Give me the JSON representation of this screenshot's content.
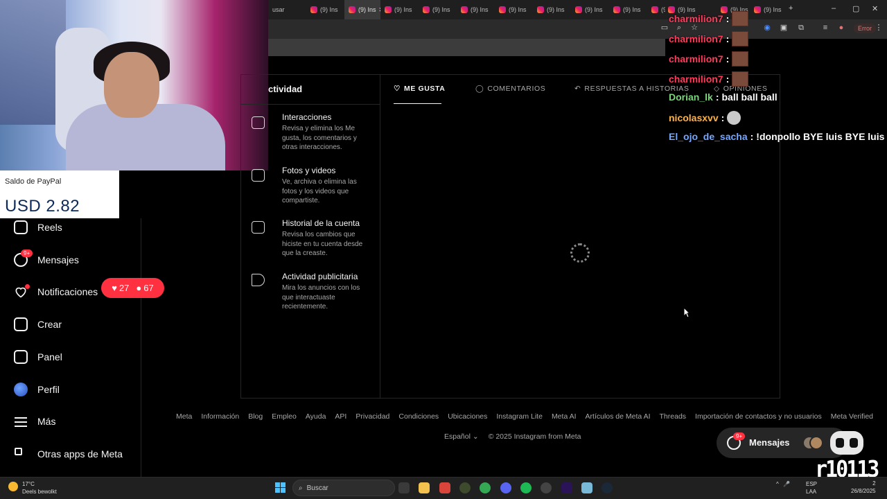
{
  "browser": {
    "tabs": [
      {
        "label": "usar"
      },
      {
        "label": "(9) Ins"
      },
      {
        "label": "(9) Ins",
        "active": true
      },
      {
        "label": "(9) Ins"
      },
      {
        "label": "(9) Ins"
      },
      {
        "label": "(9) Ins"
      },
      {
        "label": "(9) Ins"
      },
      {
        "label": "(9) Ins"
      },
      {
        "label": "(9) Ins"
      },
      {
        "label": "(9) Ins"
      },
      {
        "label": "(9) Ins"
      }
    ],
    "right_tabs": [
      "(9) Ins",
      "(9) Ins",
      "(9) Ins"
    ],
    "error_label": "Error"
  },
  "paypal": {
    "title": "Saldo de PayPal",
    "balance": "USD 2.82"
  },
  "sidebar": {
    "items": [
      {
        "label": "Reels",
        "icon": "reels-icon"
      },
      {
        "label": "Mensajes",
        "icon": "messenger-icon",
        "badge": "9+"
      },
      {
        "label": "Notificaciones",
        "icon": "heart-icon"
      },
      {
        "label": "Crear",
        "icon": "plus-square-icon"
      },
      {
        "label": "Panel",
        "icon": "dashboard-icon"
      },
      {
        "label": "Perfil",
        "icon": "avatar"
      },
      {
        "label": "Más",
        "icon": "menu-icon"
      },
      {
        "label": "Otras apps de Meta",
        "icon": "meta-apps-icon"
      }
    ],
    "notif_pill": {
      "likes": "27",
      "followers": "67"
    }
  },
  "activity": {
    "title": "ctividad",
    "items": [
      {
        "heading": "Interacciones",
        "desc": "Revisa y elimina los Me gusta, los comentarios y otras interacciones.",
        "icon": "interactions-icon"
      },
      {
        "heading": "Fotos y videos",
        "desc": "Ve, archiva o elimina las fotos y los videos que compartiste.",
        "icon": "photos-icon"
      },
      {
        "heading": "Historial de la cuenta",
        "desc": "Revisa los cambios que hiciste en tu cuenta desde que la creaste.",
        "icon": "calendar-icon"
      },
      {
        "heading": "Actividad publicitaria",
        "desc": "Mira los anuncios con los que interactuaste recientemente.",
        "icon": "megaphone-icon"
      }
    ],
    "tabs": [
      {
        "label": "ME GUSTA",
        "icon": "heart-icon"
      },
      {
        "label": "COMENTARIOS",
        "icon": "comment-icon"
      },
      {
        "label": "RESPUESTAS A HISTORIAS",
        "icon": "reply-icon"
      },
      {
        "label": "OPINIONES",
        "icon": "tag-icon"
      }
    ]
  },
  "chat": [
    {
      "user": "charmilion7",
      "msg": "",
      "emote": true,
      "cls": "u1"
    },
    {
      "user": "charmilion7",
      "msg": "",
      "emote": true,
      "cls": "u1"
    },
    {
      "user": "charmilion7",
      "msg": "",
      "emote": true,
      "cls": "u1"
    },
    {
      "user": "charmilion7",
      "msg": "",
      "emote": true,
      "cls": "u1"
    },
    {
      "user": "Dorian_lk",
      "msg": "ball ball ball",
      "emote": false,
      "cls": "u2"
    },
    {
      "user": "nicolasxvv",
      "msg": "",
      "emote": true,
      "cls": "u3"
    },
    {
      "user": "El_ojo_de_sacha",
      "msg": "!donpollo BYE luis BYE luis",
      "emote": false,
      "cls": "u4"
    }
  ],
  "footer": {
    "links": [
      "Meta",
      "Información",
      "Blog",
      "Empleo",
      "Ayuda",
      "API",
      "Privacidad",
      "Condiciones",
      "Ubicaciones",
      "Instagram Lite",
      "Meta AI",
      "Artículos de Meta AI",
      "Threads",
      "Importación de contactos y no usuarios",
      "Meta Verified"
    ],
    "language": "Español",
    "copyright": "© 2025 Instagram from Meta"
  },
  "messages_float": {
    "label": "Mensajes",
    "badge": "9+"
  },
  "logo_text": "r10113",
  "taskbar": {
    "weather_temp": "17°C",
    "weather_desc": "Deels bewolkt",
    "search_placeholder": "Buscar",
    "lang1": "ESP",
    "lang2": "LAA",
    "time": "2",
    "date": "26/8/2025"
  }
}
